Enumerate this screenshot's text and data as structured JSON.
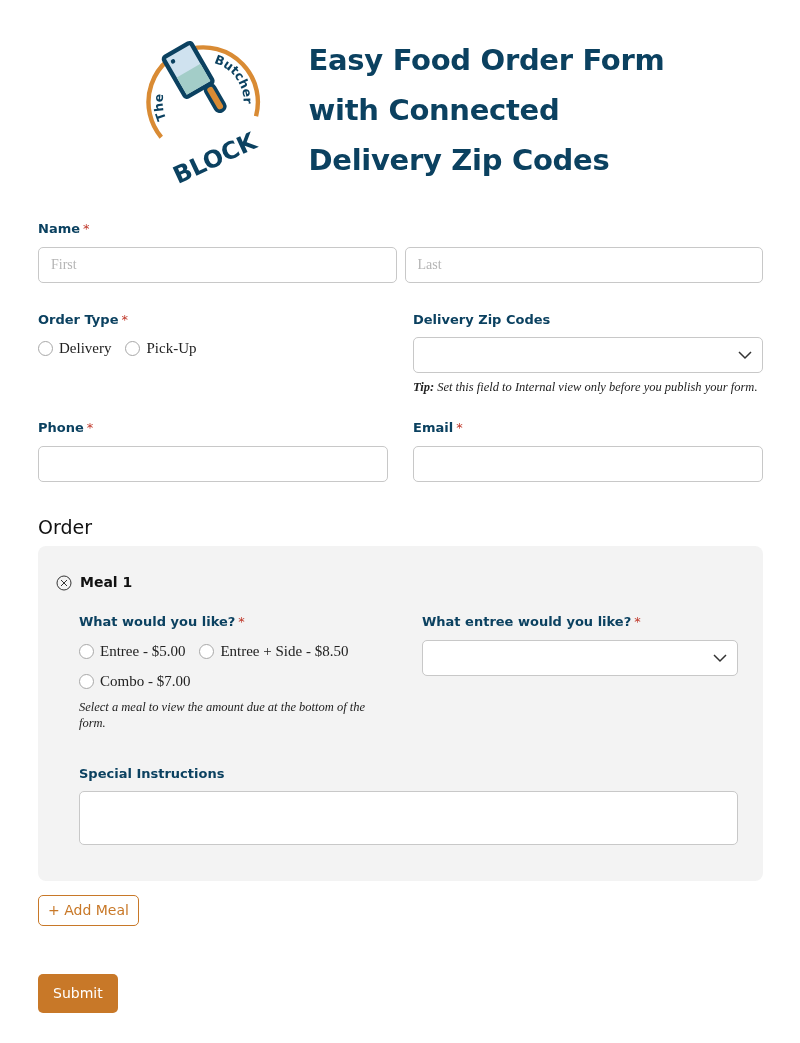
{
  "logo": {
    "side_text": "The",
    "top_text": "Butcher",
    "bottom_text": "BLOCK"
  },
  "title_lines": [
    "Easy Food Order Form",
    "with Connected",
    "Delivery Zip Codes"
  ],
  "name": {
    "label": "Name",
    "required_mark": "*",
    "first": {
      "placeholder": "First"
    },
    "last": {
      "placeholder": "Last"
    }
  },
  "order_type": {
    "label": "Order Type",
    "required_mark": "*",
    "options": [
      {
        "label": "Delivery",
        "selected": false
      },
      {
        "label": "Pick-Up",
        "selected": false
      }
    ]
  },
  "zip": {
    "label": "Delivery Zip Codes",
    "tip_bold": "Tip:",
    "tip": "Set this field to Internal view only before you publish your form."
  },
  "phone": {
    "label": "Phone",
    "required_mark": "*"
  },
  "email": {
    "label": "Email",
    "required_mark": "*"
  },
  "order_heading": "Order",
  "meal": {
    "title": "Meal 1",
    "choice_label": "What would you like?",
    "choice_mark": "*",
    "options": [
      {
        "label": "Entree - $5.00",
        "selected": false
      },
      {
        "label": "Entree + Side - $8.50",
        "selected": false
      },
      {
        "label": "Combo - $7.00",
        "selected": false
      }
    ],
    "choice_help": "Select a meal to view the amount due at the bottom of the form.",
    "entree_label": "What entree would you like?",
    "entree_mark": "*",
    "instructions_label": "Special Instructions"
  },
  "add_button": {
    "icon": "+",
    "label": "Add Meal"
  },
  "submit": "Submit"
}
